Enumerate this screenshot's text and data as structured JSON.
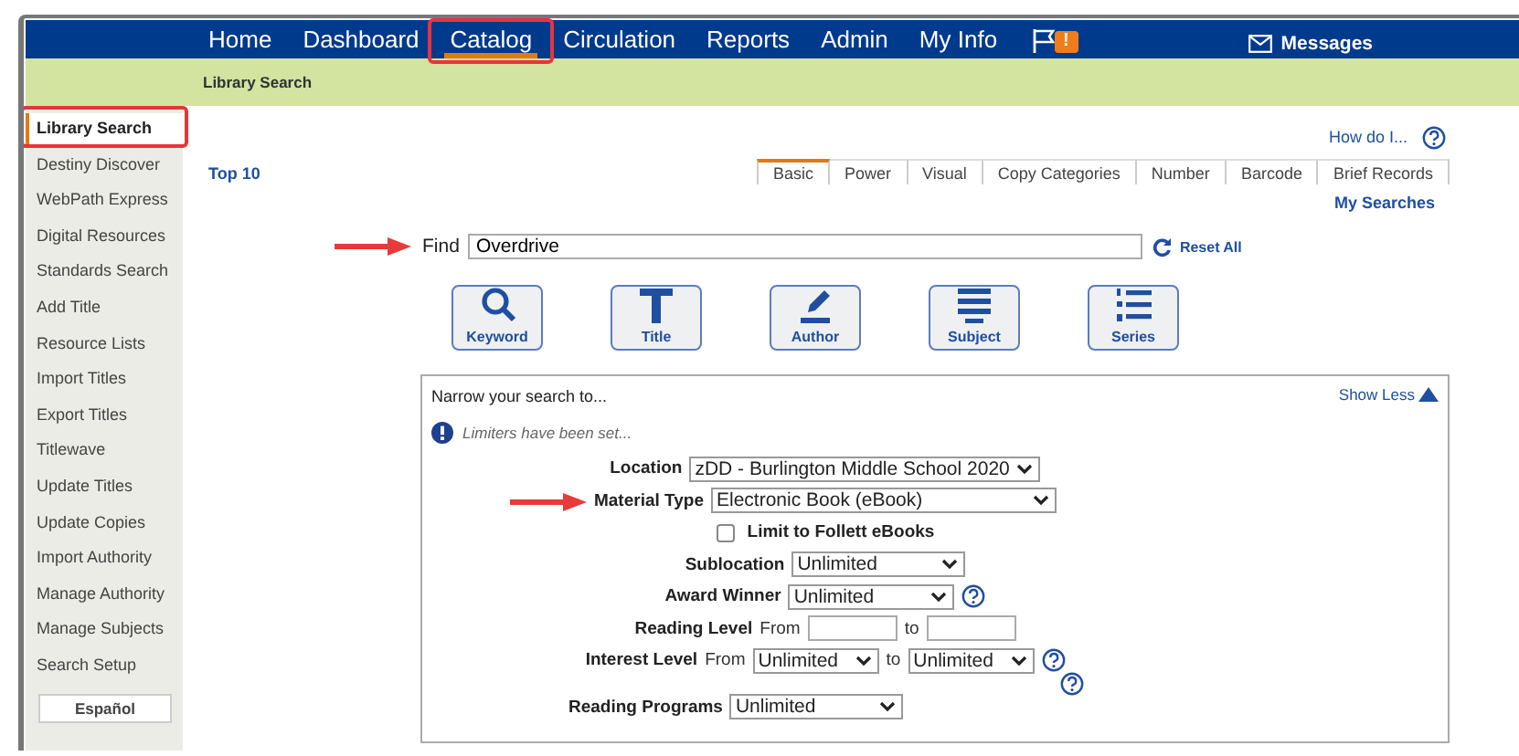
{
  "nav": {
    "items": [
      {
        "label": "Home",
        "selected": false,
        "highlighted": false
      },
      {
        "label": "Dashboard",
        "selected": false,
        "highlighted": false
      },
      {
        "label": "Catalog",
        "selected": true,
        "highlighted": true
      },
      {
        "label": "Circulation",
        "selected": false,
        "highlighted": false
      },
      {
        "label": "Reports",
        "selected": false,
        "highlighted": false
      },
      {
        "label": "Admin",
        "selected": false,
        "highlighted": false
      },
      {
        "label": "My Info",
        "selected": false,
        "highlighted": false
      }
    ],
    "alert_badge": "!",
    "messages": "Messages"
  },
  "breadcrumb": "Library Search",
  "sidebar": {
    "items": [
      {
        "label": "Library Search",
        "selected": true,
        "highlighted": true
      },
      {
        "label": "Destiny Discover",
        "selected": false,
        "highlighted": false
      },
      {
        "label": "WebPath Express",
        "selected": false,
        "highlighted": false
      },
      {
        "label": "Digital Resources",
        "selected": false,
        "highlighted": false
      },
      {
        "label": "Standards Search",
        "selected": false,
        "highlighted": false
      },
      {
        "label": "Add Title",
        "selected": false,
        "highlighted": false
      },
      {
        "label": "Resource Lists",
        "selected": false,
        "highlighted": false
      },
      {
        "label": "Import Titles",
        "selected": false,
        "highlighted": false
      },
      {
        "label": "Export Titles",
        "selected": false,
        "highlighted": false
      },
      {
        "label": "Titlewave",
        "selected": false,
        "highlighted": false
      },
      {
        "label": "Update Titles",
        "selected": false,
        "highlighted": false
      },
      {
        "label": "Update Copies",
        "selected": false,
        "highlighted": false
      },
      {
        "label": "Import Authority",
        "selected": false,
        "highlighted": false
      },
      {
        "label": "Manage Authority",
        "selected": false,
        "highlighted": false
      },
      {
        "label": "Manage Subjects",
        "selected": false,
        "highlighted": false
      },
      {
        "label": "Search Setup",
        "selected": false,
        "highlighted": false
      }
    ],
    "language_button": "Español"
  },
  "help_link": "How do I...",
  "top10": "Top 10",
  "tabs": [
    {
      "label": "Basic",
      "selected": true
    },
    {
      "label": "Power",
      "selected": false
    },
    {
      "label": "Visual",
      "selected": false
    },
    {
      "label": "Copy Categories",
      "selected": false
    },
    {
      "label": "Number",
      "selected": false
    },
    {
      "label": "Barcode",
      "selected": false
    },
    {
      "label": "Brief Records",
      "selected": false
    }
  ],
  "my_searches": "My Searches",
  "find": {
    "label": "Find",
    "value": "Overdrive",
    "annotated": true
  },
  "reset": "Reset All",
  "search_buttons": [
    {
      "label": "Keyword",
      "kind": "keyword"
    },
    {
      "label": "Title",
      "kind": "title"
    },
    {
      "label": "Author",
      "kind": "author"
    },
    {
      "label": "Subject",
      "kind": "subject"
    },
    {
      "label": "Series",
      "kind": "series"
    }
  ],
  "limits": {
    "title": "Narrow your search to...",
    "toggle": "Show Less",
    "expanded": true,
    "notice": "Limiters have been set...",
    "fields": [
      {
        "kind": "select",
        "label": "Location",
        "value": "zDD - Burlington Middle School 2020",
        "help": false,
        "annotated": false
      },
      {
        "kind": "select",
        "label": "Material Type",
        "value": "Electronic Book (eBook)",
        "help": false,
        "annotated": true
      },
      {
        "kind": "checkbox",
        "label": "Limit to Follett eBooks",
        "checked": false
      },
      {
        "kind": "select",
        "label": "Sublocation",
        "value": "Unlimited",
        "help": false,
        "annotated": false
      },
      {
        "kind": "select",
        "label": "Award Winner",
        "value": "Unlimited",
        "help": true,
        "annotated": false
      },
      {
        "kind": "range_input",
        "label": "Reading Level",
        "from_label": "From",
        "to_label": "to"
      },
      {
        "kind": "range_select",
        "label": "Interest Level",
        "from_label": "From",
        "from_value": "Unlimited",
        "to_label": "to",
        "to_value": "Unlimited",
        "help": true
      },
      {
        "kind": "help"
      },
      {
        "kind": "select",
        "label": "Reading Programs",
        "value": "Unlimited",
        "help": false,
        "annotated": false
      }
    ]
  }
}
